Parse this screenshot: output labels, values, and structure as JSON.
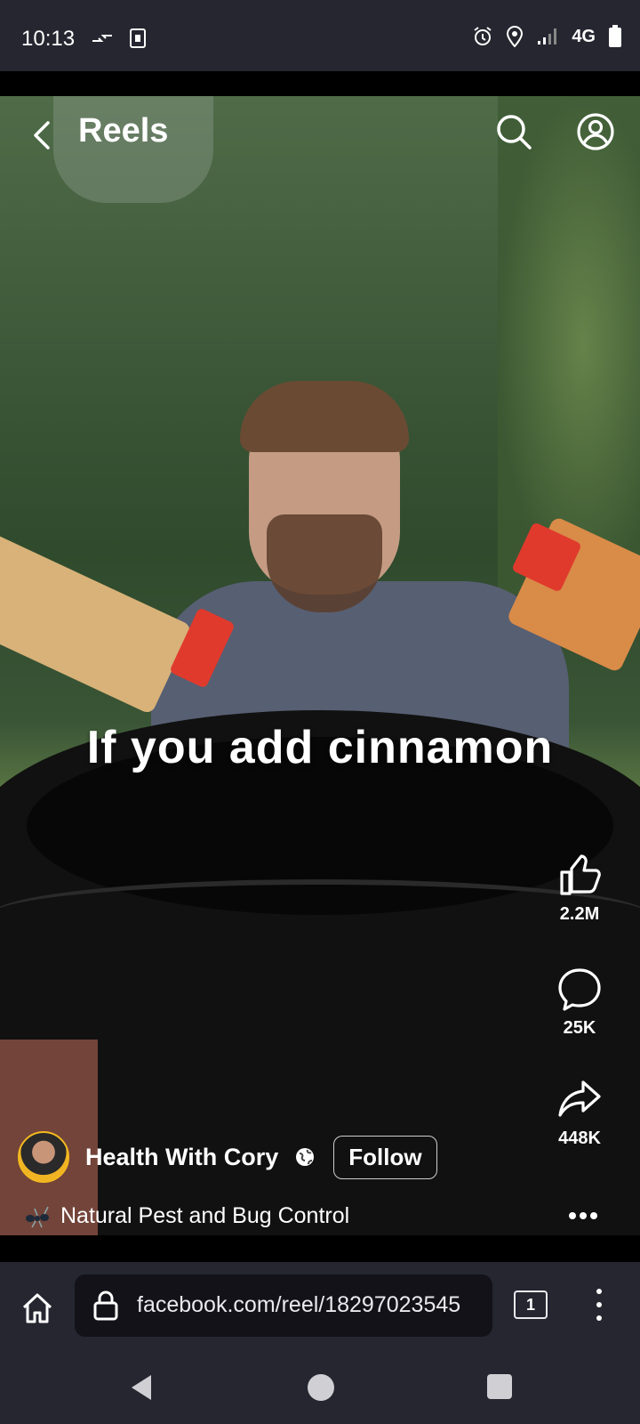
{
  "status_bar": {
    "time": "10:13",
    "network": "4G",
    "icons": [
      "data-transfer-icon",
      "sim-icon",
      "alarm-icon",
      "location-icon",
      "signal-icon",
      "battery-icon"
    ]
  },
  "header": {
    "title": "Reels",
    "icons": [
      "back-icon",
      "search-icon",
      "profile-icon"
    ]
  },
  "video": {
    "caption": "If you add cinnamon"
  },
  "actions": {
    "like_count": "2.2M",
    "comment_count": "25K",
    "share_count": "448K"
  },
  "author": {
    "name": "Health With Cory",
    "follow_label": "Follow",
    "audio_text": "Natural Pest and Bug Control"
  },
  "browser": {
    "url": "facebook.com/reel/18297023545",
    "tab_count": "1"
  },
  "colors": {
    "bar_background": "#262631",
    "text": "#ffffff"
  }
}
